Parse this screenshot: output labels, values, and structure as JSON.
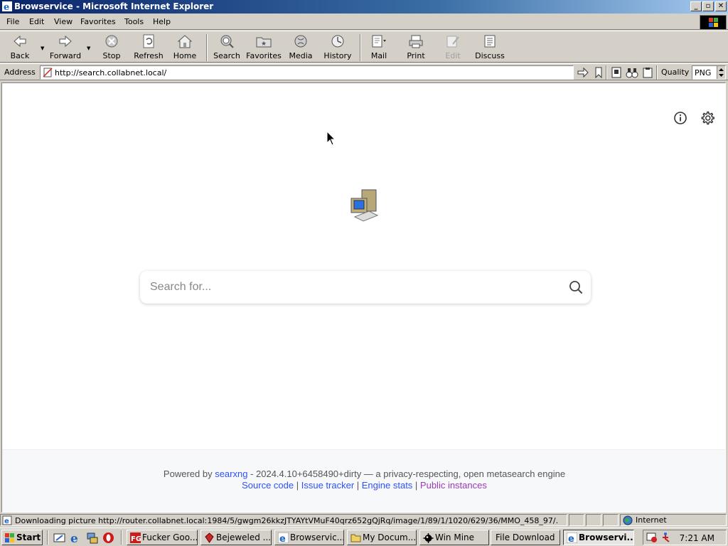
{
  "window": {
    "title": "Browservice - Microsoft Internet Explorer",
    "caption_buttons": [
      "_",
      "▫",
      "✕"
    ]
  },
  "menu": {
    "items": [
      {
        "label": "File",
        "accel": "F"
      },
      {
        "label": "Edit",
        "accel": "E"
      },
      {
        "label": "View",
        "accel": "V"
      },
      {
        "label": "Favorites",
        "accel": "a"
      },
      {
        "label": "Tools",
        "accel": "T"
      },
      {
        "label": "Help",
        "accel": "H"
      }
    ]
  },
  "toolbar": {
    "back": "Back",
    "forward": "Forward",
    "stop": "Stop",
    "refresh": "Refresh",
    "home": "Home",
    "search": "Search",
    "favorites": "Favorites",
    "media": "Media",
    "history": "History",
    "mail": "Mail",
    "print": "Print",
    "edit": "Edit",
    "discuss": "Discuss"
  },
  "address": {
    "label": "Address",
    "url": "http://search.collabnet.local/",
    "quality_label": "Quality",
    "quality_value": "PNG"
  },
  "page": {
    "search_placeholder": "Search for...",
    "footer": {
      "powered_by": "Powered by",
      "engine_name": "searxng",
      "version_text": " - 2024.4.10+6458490+dirty — a privacy-respecting, open metasearch engine",
      "links": [
        "Source code",
        "Issue tracker",
        "Engine stats",
        "Public instances"
      ],
      "separator": " | "
    }
  },
  "statusbar": {
    "text": "Downloading picture http://router.collabnet.local:1984/5/gwgm26kkzJTYAYtVMuF40qrz652gQjRq/image/1/89/1/1020/629/36/MMO_458_97/.",
    "zone": "Internet"
  },
  "taskbar": {
    "start": "Start",
    "tasks": [
      {
        "label": "Fucker Goo...",
        "icon": "fg-icon",
        "active": false
      },
      {
        "label": "Bejeweled ...",
        "icon": "gem-icon",
        "active": false
      },
      {
        "label": "Browservic...",
        "icon": "ie-icon",
        "active": false
      },
      {
        "label": "My Docum...",
        "icon": "folder-icon",
        "active": false
      },
      {
        "label": "Win Mine",
        "icon": "mine-icon",
        "active": false
      },
      {
        "label": "File Download",
        "icon": "",
        "active": false
      },
      {
        "label": "Browservi...",
        "icon": "ie-icon",
        "active": true
      }
    ],
    "clock": "7:21 AM"
  }
}
